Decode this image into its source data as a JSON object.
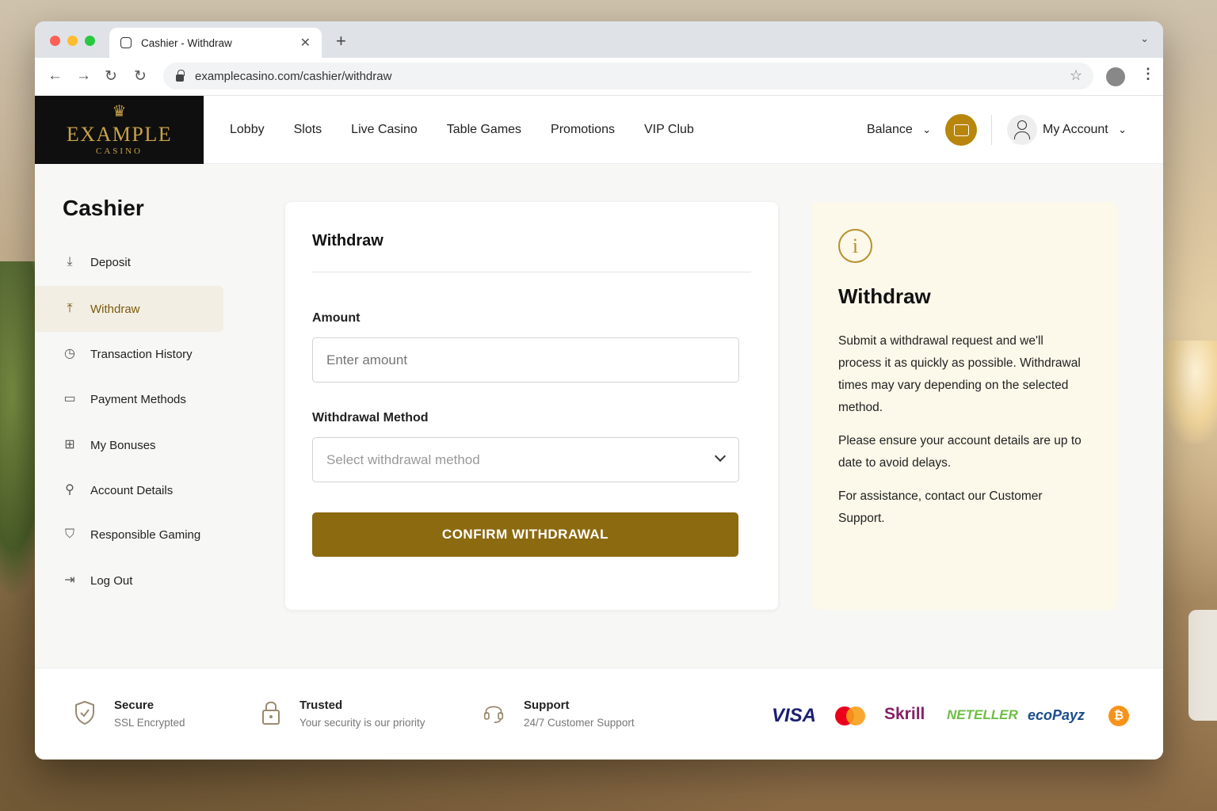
{
  "browser": {
    "tab_title": "Cashier - Withdraw",
    "url": "examplecasino.com/cashier/withdraw"
  },
  "header": {
    "logo_name": "EXAMPLE",
    "logo_sub": "CASINO",
    "nav": [
      "Lobby",
      "Slots",
      "Live Casino",
      "Table Games",
      "Promotions",
      "VIP Club"
    ],
    "balance_label": "Balance",
    "account_label": "My Account",
    "accent": "#b8860b"
  },
  "sidebar": {
    "title": "Cashier",
    "items": [
      {
        "label": "Deposit",
        "icon": "download-icon"
      },
      {
        "label": "Withdraw",
        "icon": "upload-icon",
        "active": true
      },
      {
        "label": "Transaction History",
        "icon": "clock-icon"
      },
      {
        "label": "Payment Methods",
        "icon": "card-icon"
      },
      {
        "label": "My Bonuses",
        "icon": "gift-icon"
      },
      {
        "label": "Account Details",
        "icon": "user-icon"
      },
      {
        "label": "Responsible Gaming",
        "icon": "shield-check-icon"
      },
      {
        "label": "Log Out",
        "icon": "logout-icon"
      }
    ]
  },
  "form": {
    "title": "Withdraw",
    "amount_label": "Amount",
    "amount_placeholder": "Enter amount",
    "method_label": "Withdrawal Method",
    "method_placeholder": "Select withdrawal method",
    "confirm_label": "CONFIRM WITHDRAWAL",
    "button_color": "#8c6a0f"
  },
  "info": {
    "title": "Withdraw",
    "p1": "Submit a withdrawal request and we'll process it as quickly as possible. Withdrawal times may vary depending on the selected method.",
    "p2": "Please ensure your account details are up to date to avoid delays.",
    "p3": "For assistance, contact our Customer Support."
  },
  "footer": {
    "features": [
      {
        "title": "Secure",
        "desc": "SSL Encrypted",
        "icon": "shield-icon"
      },
      {
        "title": "Trusted",
        "desc": "Your security is our priority",
        "icon": "lock-icon"
      },
      {
        "title": "Support",
        "desc": "24/7 Customer Support",
        "icon": "headset-icon"
      }
    ],
    "payments": {
      "visa": "VISA",
      "skrill": "Skrill",
      "neteller": "NETELLER",
      "ecopayz": "ecoPayz",
      "bitcoin": "₿"
    }
  }
}
